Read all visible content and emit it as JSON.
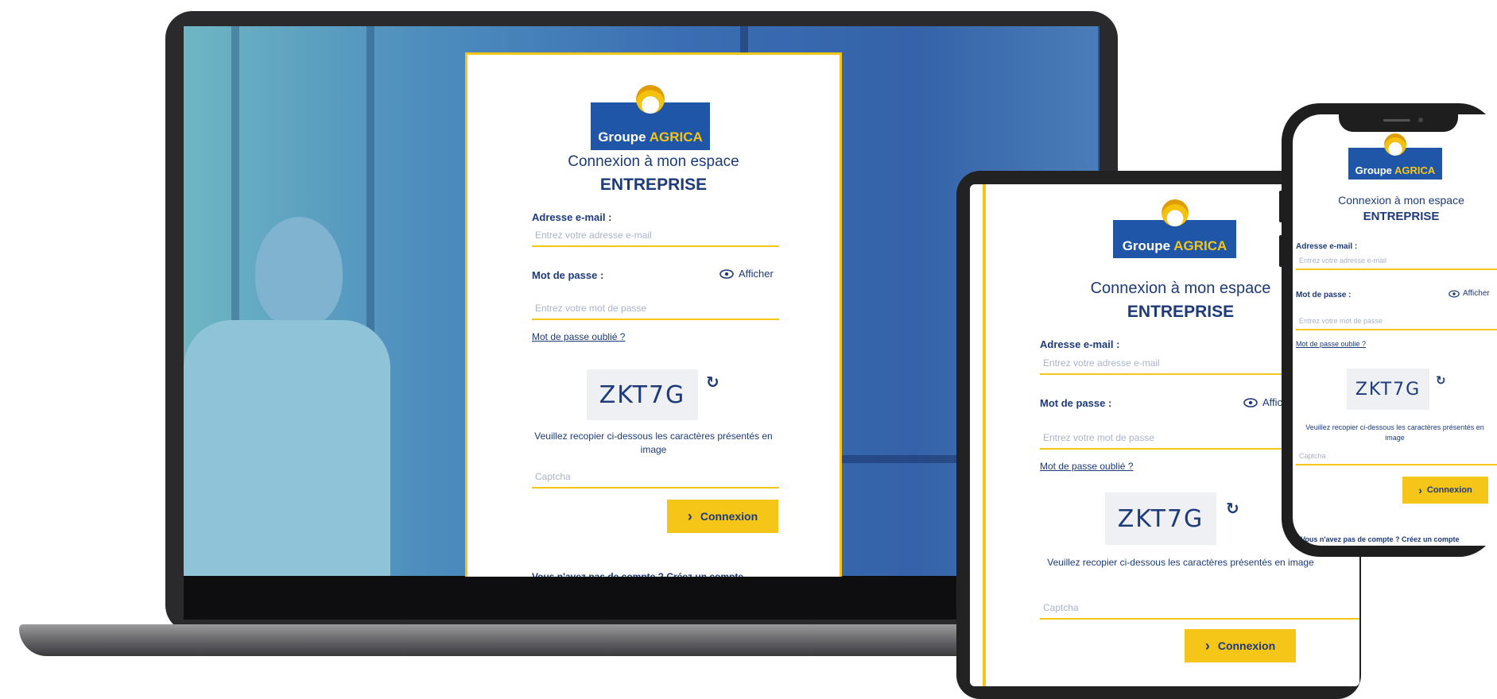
{
  "brand": {
    "name_white": "Groupe",
    "name_yellow": "AGRICA"
  },
  "form": {
    "heading_line1": "Connexion à mon espace",
    "heading_line2": "ENTREPRISE",
    "email_label": "Adresse e-mail :",
    "email_placeholder": "Entrez votre adresse e-mail",
    "password_label": "Mot de passe :",
    "show_password_label": "Afficher",
    "password_placeholder": "Entrez votre mot de passe",
    "forgot_password_link": "Mot de passe oublié ?",
    "captcha_text": "ZKT7G",
    "captcha_help": "Veuillez recopier ci-dessous les caractères présentés en image",
    "captcha_placeholder": "Captcha",
    "submit_label": "Connexion",
    "signup_prompt": "Vous n'avez pas de compte ? Créez un compte"
  },
  "colors": {
    "brand_blue": "#1f56a8",
    "accent_yellow": "#f5c518",
    "text_navy": "#1d3a7a"
  },
  "icons": {
    "show": "eye-icon",
    "refresh": "refresh-icon",
    "submit": "chevron-right-icon"
  }
}
